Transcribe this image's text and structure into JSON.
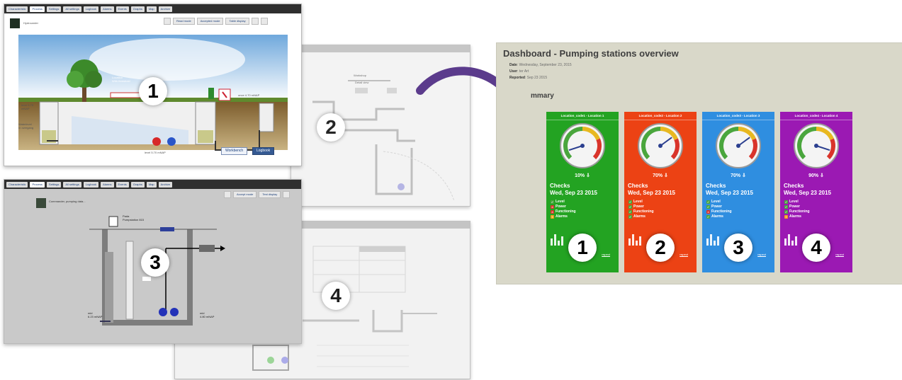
{
  "screen1": {
    "tabs": [
      "Characteristic",
      "Process",
      "Settings",
      "All settings",
      "Logbook",
      "Alarms",
      "Events",
      "Graphs",
      "Map",
      "Archive"
    ],
    "header_label": "Hydrounder",
    "toolbar": [
      "Read mode",
      "Accepted mode",
      "Table display"
    ],
    "labels": {
      "mid": "Location\nWith threshold",
      "right": "once 4.70 mNAP",
      "left": "level 6.75\nmNAP",
      "left2": "Waterlevel\nIn overgang",
      "bottom": "level 5.70 mNAP"
    },
    "buttons": [
      "Workbench",
      "Logbook"
    ],
    "badge": "1"
  },
  "screen2": {
    "badge": "2",
    "labels": [
      "Workshop",
      "Detail view"
    ]
  },
  "screen3": {
    "tabs": [
      "Characteristic",
      "Process",
      "Settings",
      "All settings",
      "Logbook",
      "Alarms",
      "Events",
      "Graphs",
      "Map",
      "Archive"
    ],
    "header_label": "Commander, pumping data...",
    "toolbar": [
      "Accept mode",
      "Test display"
    ],
    "labels": {
      "top": "Pada\nPumpstation 815",
      "inlet": "mid\n6.23 mNAP",
      "outlet": "mid\n4.80 mNAP"
    },
    "badge": "3"
  },
  "screen4": {
    "badge": "4"
  },
  "dashboard": {
    "title": "Dashboard - Pumping stations overview",
    "meta": [
      {
        "label": "Date",
        "value": "Wednesday, September 23, 2015"
      },
      {
        "label": "User",
        "value": "ter Art"
      },
      {
        "label": "Reported",
        "value": "Sep 23 2015"
      }
    ],
    "summary_heading": "mmary",
    "checks_title": "Checks",
    "checks_date": "Wed, Sep 23 2015",
    "check_labels": [
      "Level",
      "Power",
      "Functioning",
      "Alarms"
    ],
    "link_label": "nspect",
    "cards": [
      {
        "location": "Location_code1 - Location 1",
        "percent": "10%",
        "value": 0.1,
        "color": "#23a322",
        "badge": "1",
        "status": [
          "ok",
          "bad",
          "bad",
          "warn"
        ]
      },
      {
        "location": "Location_code2 - Location 2",
        "percent": "70%",
        "value": 0.7,
        "color": "#ec4214",
        "badge": "2",
        "status": [
          "ok",
          "ok",
          "ok",
          "ok"
        ]
      },
      {
        "location": "Location_code3 - Location 3",
        "percent": "70%",
        "value": 0.7,
        "color": "#2f8ee0",
        "badge": "3",
        "status": [
          "ok",
          "ok",
          "bad",
          "ok"
        ]
      },
      {
        "location": "Location_code4 - Location 4",
        "percent": "90%",
        "value": 0.9,
        "color": "#9b19b3",
        "badge": "4",
        "status": [
          "ok",
          "ok",
          "ok",
          "warn"
        ]
      }
    ]
  },
  "colors": {
    "arrow": "#5b3b8c",
    "gauge_green": "#4aa63d",
    "gauge_yellow": "#e8b820",
    "gauge_red": "#d9342b"
  }
}
